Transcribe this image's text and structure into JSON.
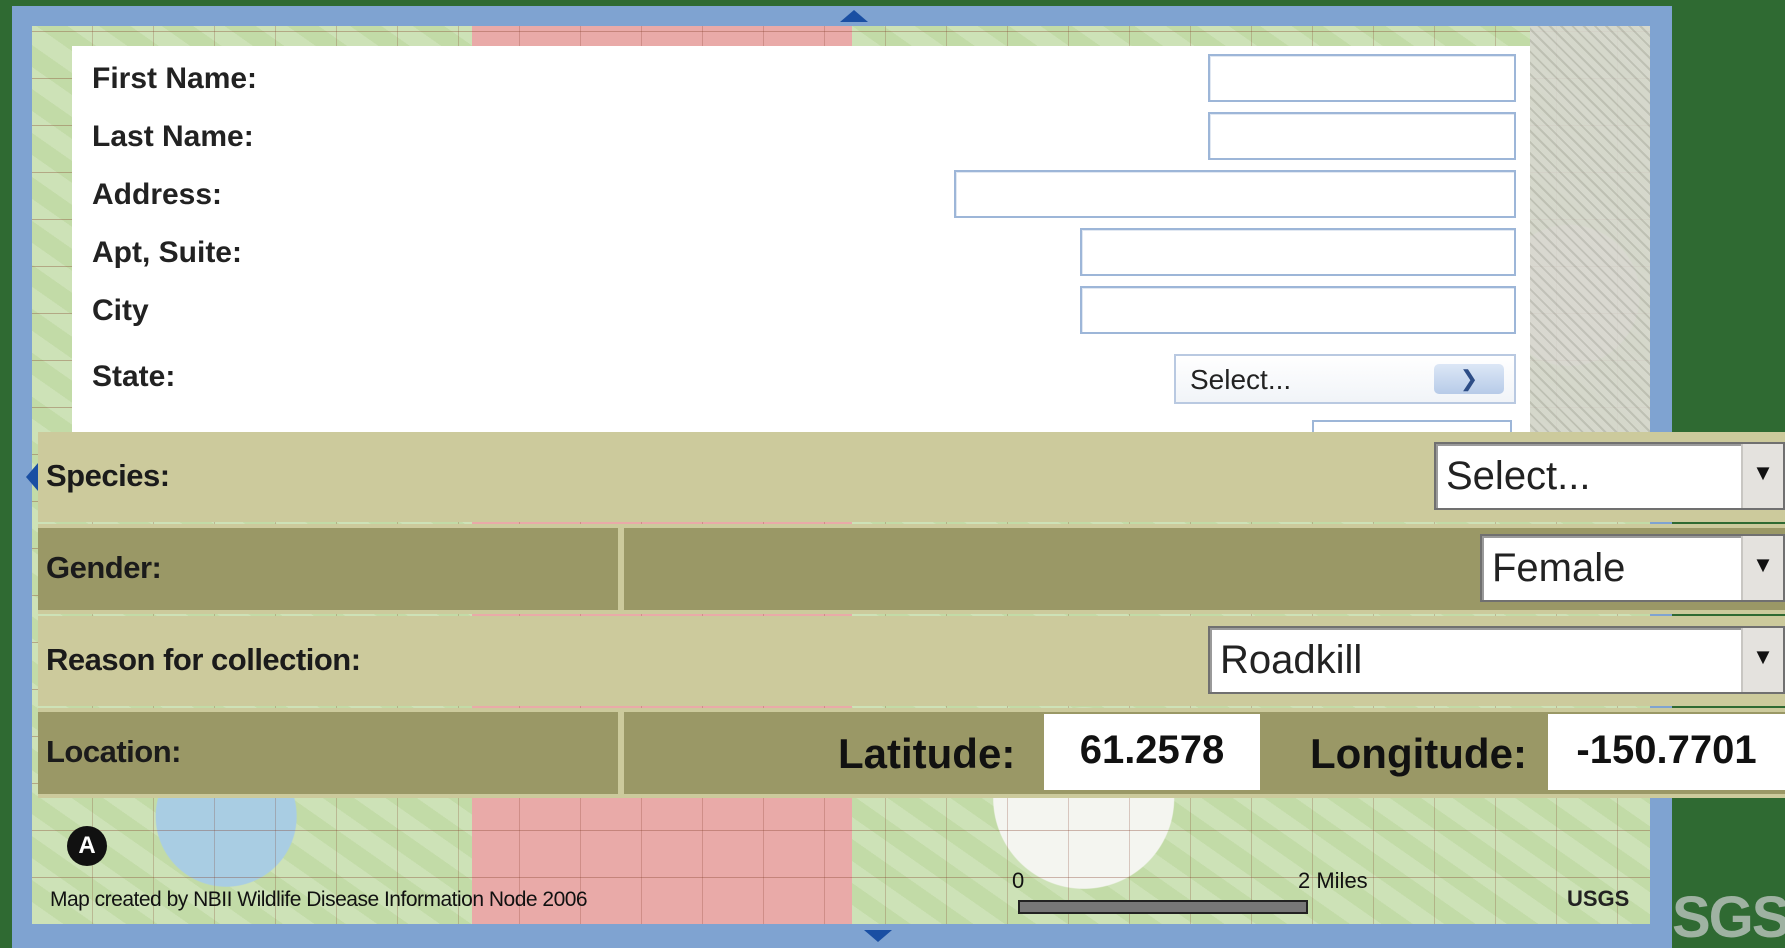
{
  "address_form": {
    "first_name_label": "First Name:",
    "last_name_label": "Last Name:",
    "address_label": "Address:",
    "apt_suite_label": "Apt, Suite:",
    "city_label": "City",
    "state_label": "State:",
    "state_value": "Select..."
  },
  "collection_form": {
    "species_label": "Species:",
    "species_value": "Select...",
    "gender_label": "Gender:",
    "gender_value": "Female",
    "reason_label": "Reason for collection:",
    "reason_value": "Roadkill",
    "location_label": "Location:",
    "latitude_label": "Latitude:",
    "latitude_value": "61.2578",
    "longitude_label": "Longitude:",
    "longitude_value": "-150.7701"
  },
  "map": {
    "credit": "Map created by NBII Wildlife Disease Information Node 2006",
    "north_label": "A",
    "scale_start": "0",
    "scale_end": "2 Miles",
    "usgs_label": "USGS",
    "brand_fragment": "SGS"
  },
  "colors": {
    "form_band": "#ccca9c",
    "form_cell_dark": "#9a9866",
    "frame_blue": "#7fa3d1",
    "page_green": "#2f6a32"
  },
  "icons": [
    "pan-up-arrow",
    "pan-down-arrow",
    "pan-left-arrow",
    "chevron-down-icon",
    "dropdown-arrow-icon",
    "north-arrow-icon"
  ]
}
